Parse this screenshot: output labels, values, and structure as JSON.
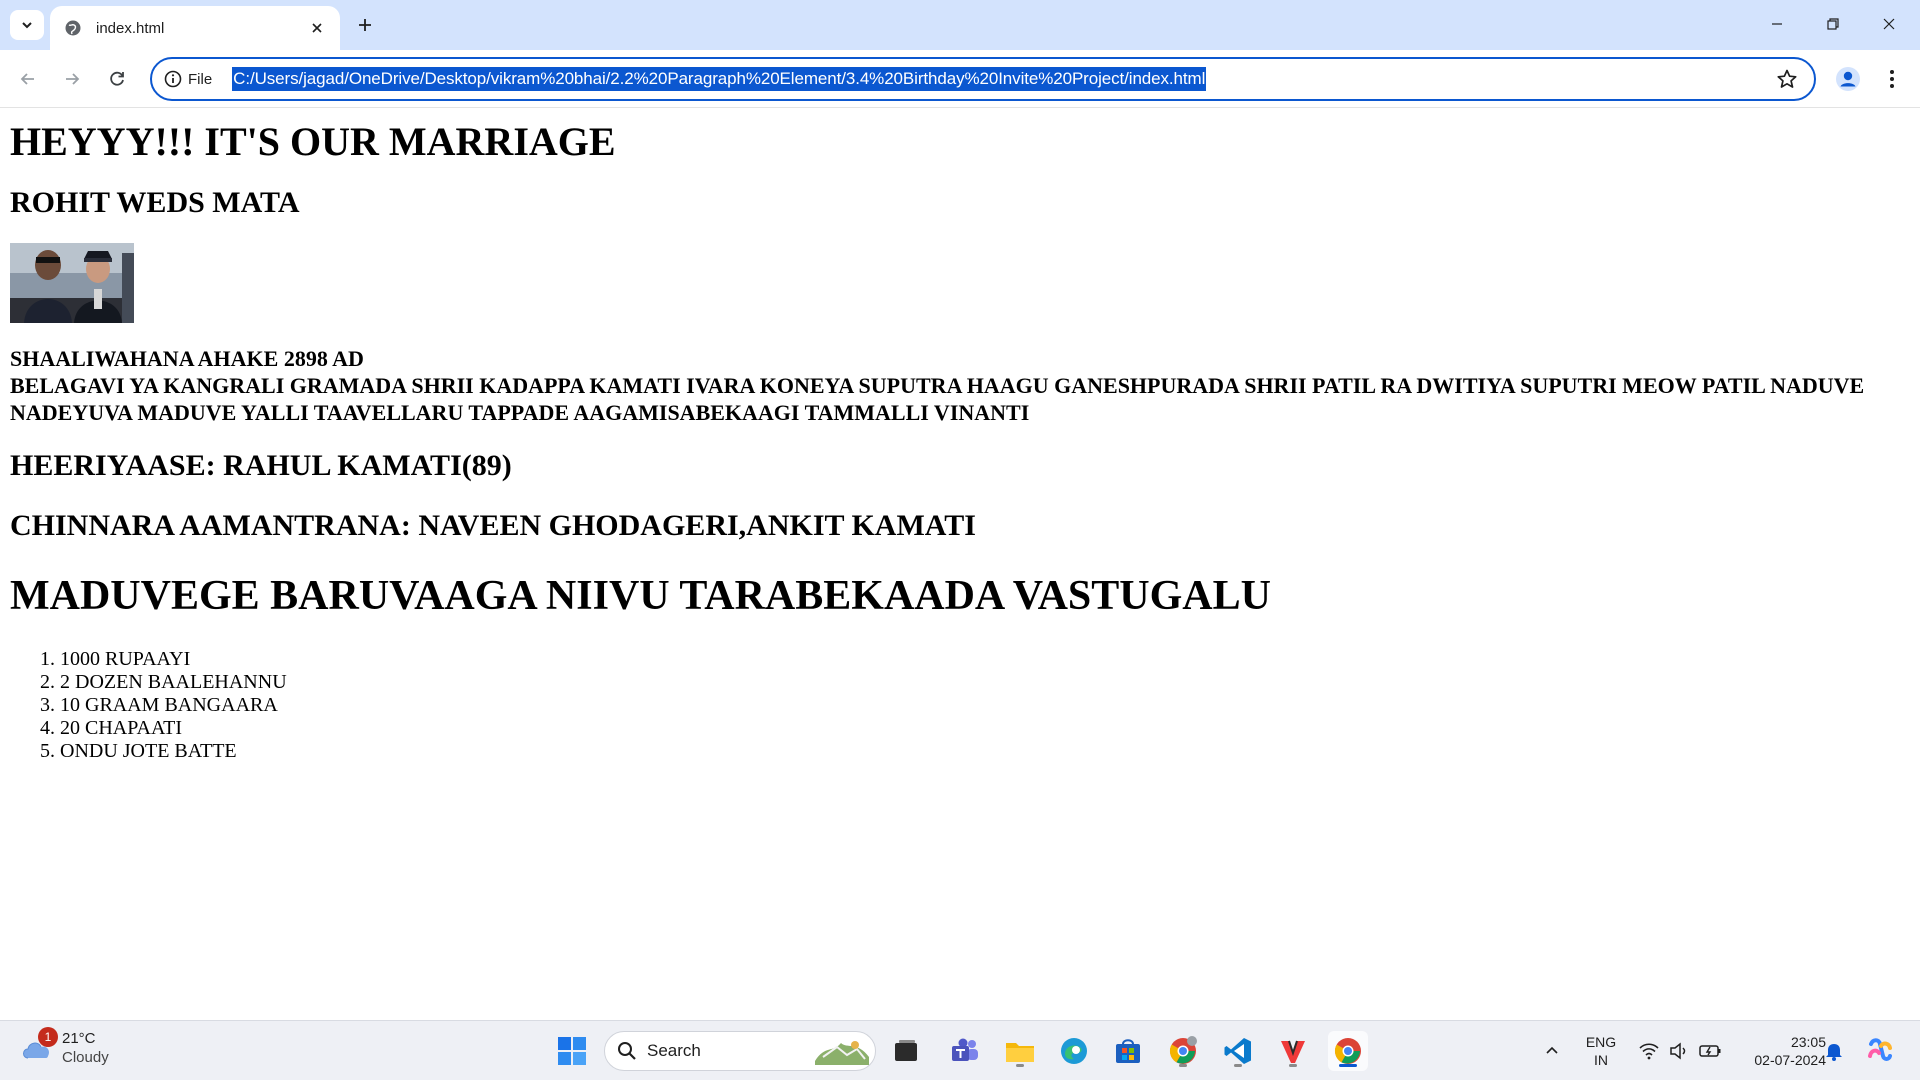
{
  "browser": {
    "tab_title": "index.html",
    "site_chip_label": "File",
    "url": "C:/Users/jagad/OneDrive/Desktop/vikram%20bhai/2.2%20Paragraph%20Element/3.4%20Birthday%20Invite%20Project/index.html"
  },
  "page": {
    "heading": "HEYYY!!! IT'S OUR MARRIAGE",
    "subheading": "ROHIT WEDS MATA",
    "paragraph_line1": "SHAALIWAHANA AHAKE 2898 AD",
    "paragraph_line2": "BELAGAVI YA KANGRALI GRAMADA SHRII KADAPPA KAMATI IVARA KONEYA SUPUTRA HAAGU GANESHPURADA SHRII PATIL RA DWITIYA SUPUTRI MEOW PATIL NADUVE NADEYUVA MADUVE YALLI TAAVELLARU TAPPADE AAGAMISABEKAAGI TAMMALLI VINANTI",
    "host": "HEERIYAASE: RAHUL KAMATI(89)",
    "kids_invite": "CHINNARA AAMANTRANA: NAVEEN GHODAGERI,ANKIT KAMATI",
    "list_heading": "MADUVEGE BARUVAAGA NIIVU TARABEKAADA VASTUGALU",
    "items": [
      "1000 RUPAAYI",
      "2 DOZEN BAALEHANNU",
      "10 GRAAM BANGAARA",
      "20 CHAPAATI",
      "ONDU JOTE BATTE"
    ]
  },
  "taskbar": {
    "weather_temp": "21°C",
    "weather_desc": "Cloudy",
    "weather_badge": "1",
    "search_label": "Search",
    "lang_top": "ENG",
    "lang_bottom": "IN",
    "time": "23:05",
    "date": "02-07-2024"
  },
  "colors": {
    "tabstrip": "#d3e3fd",
    "accent": "#0b57d0"
  }
}
